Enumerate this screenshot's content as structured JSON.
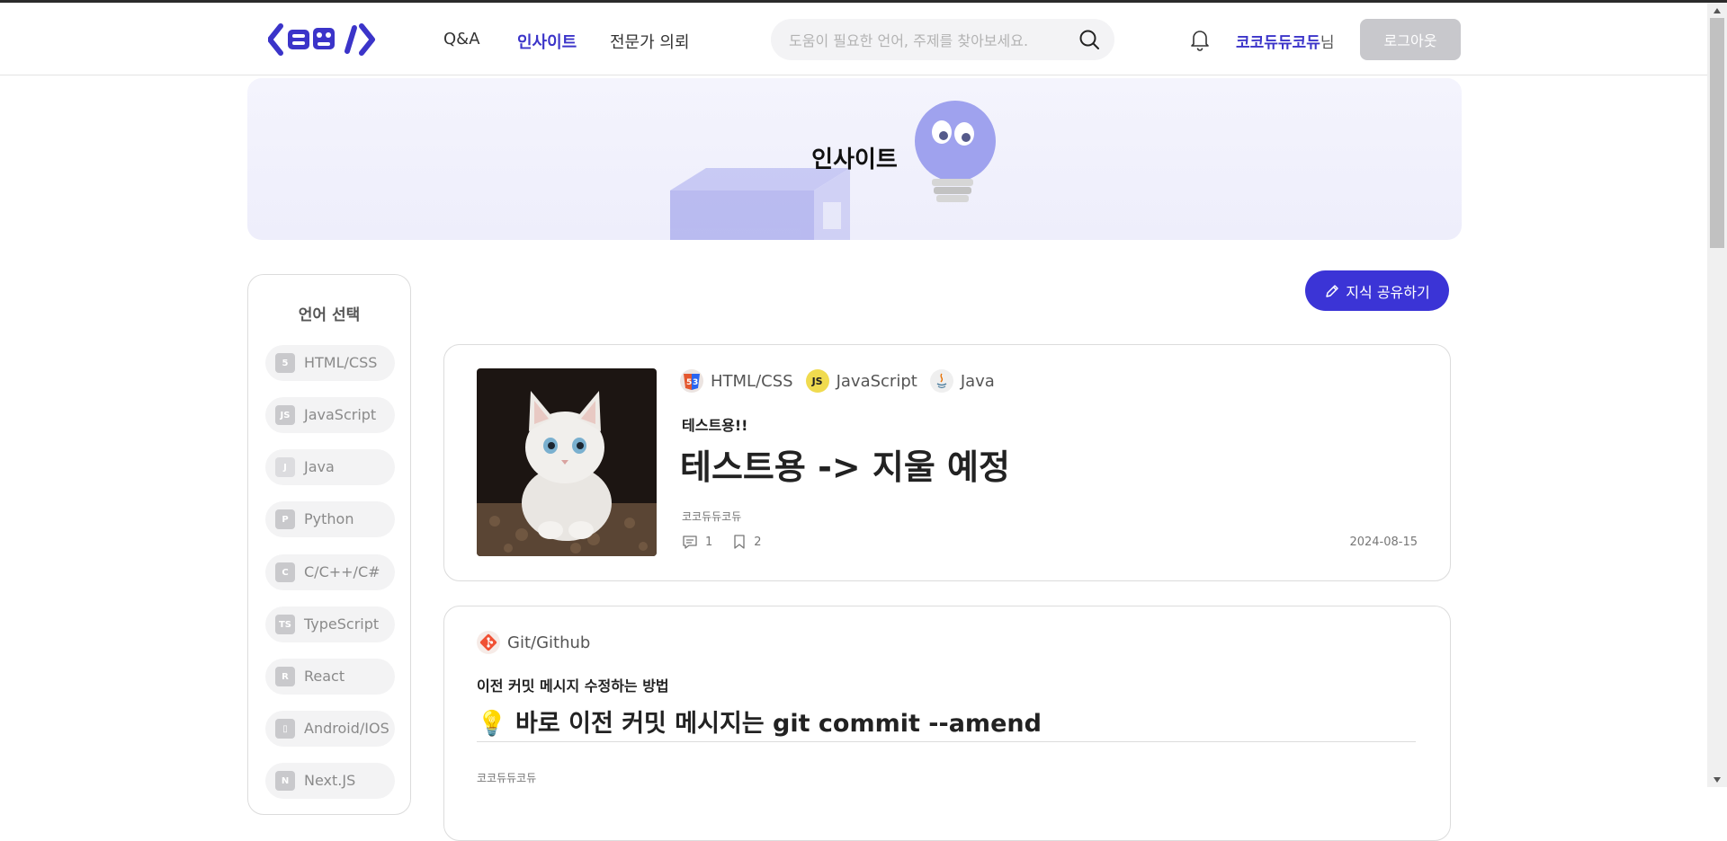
{
  "header": {
    "logo_text": "코뮤",
    "nav": [
      {
        "label": "Q&A",
        "active": false
      },
      {
        "label": "인사이트",
        "active": true
      },
      {
        "label": "전문가 의뢰",
        "active": false
      }
    ],
    "search_placeholder": "도움이 필요한 언어, 주제를 찾아보세요.",
    "username": "코코듀듀코듀",
    "username_suffix": "님",
    "logout_label": "로그아웃"
  },
  "banner": {
    "title": "인사이트"
  },
  "sidebar": {
    "title": "언어 선택",
    "items": [
      {
        "label": "HTML/CSS",
        "icon": "html-css-icon",
        "glyph": "5"
      },
      {
        "label": "JavaScript",
        "icon": "javascript-icon",
        "glyph": "JS"
      },
      {
        "label": "Java",
        "icon": "java-icon",
        "glyph": "J"
      },
      {
        "label": "Python",
        "icon": "python-icon",
        "glyph": "P"
      },
      {
        "label": "C/C++/C#",
        "icon": "c-icon",
        "glyph": "C"
      },
      {
        "label": "TypeScript",
        "icon": "typescript-icon",
        "glyph": "TS"
      },
      {
        "label": "React",
        "icon": "react-icon",
        "glyph": "R"
      },
      {
        "label": "Android/IOS",
        "icon": "mobile-icon",
        "glyph": "▯"
      },
      {
        "label": "Next.JS",
        "icon": "nextjs-icon",
        "glyph": "N"
      }
    ]
  },
  "write_button": {
    "label": "지식 공유하기"
  },
  "posts": [
    {
      "tags": [
        "HTML/CSS",
        "JavaScript",
        "Java"
      ],
      "subtitle": "테스트용!!",
      "title": "테스트용 -> 지울 예정",
      "author": "코코듀듀코듀",
      "comments": "1",
      "bookmarks": "2",
      "date": "2024-08-15"
    },
    {
      "tags": [
        "Git/Github"
      ],
      "subtitle": "이전 커밋 메시지 수정하는 방법",
      "title_emoji": "💡",
      "title": "바로 이전 커밋 메시지는 git commit --amend",
      "author": "코코듀듀코듀"
    }
  ],
  "colors": {
    "accent": "#3b34d6",
    "banner_bg": "#f1f1fc",
    "logout_bg": "#c8c8cc"
  }
}
